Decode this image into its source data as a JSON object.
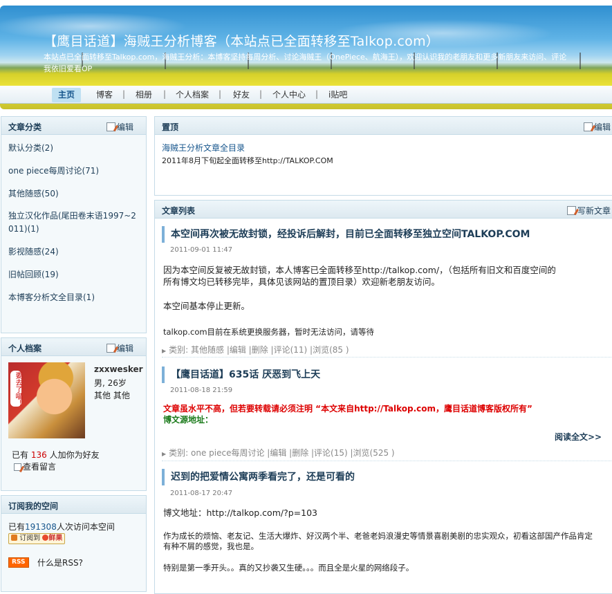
{
  "header": {
    "title": "【鹰目话道】海贼王分析博客（本站点已全面转移至Talkop.com）",
    "description": "本站点已全面转移至Talkop.com，海贼王分析：本博客坚持每周分析、讨论海贼王（OnePiece、航海王），欢迎认识我的老朋友和更多新朋友来访问、评论",
    "description_line2": "我依旧爱看OP"
  },
  "nav": {
    "items": [
      "主页",
      "博客",
      "相册",
      "个人档案",
      "好友",
      "个人中心",
      "i贴吧"
    ],
    "active": "主页",
    "separator": "|"
  },
  "left": {
    "categories": {
      "title": "文章分类",
      "edit": "编辑",
      "items": [
        "默认分类(2)",
        "one piece每周讨论(71)",
        "其他随感(50)",
        "独立汉化作品(尾田卷末语1997~2",
        "011)(1)",
        "影视随感(24)",
        "旧帖回顾(19)",
        "本博客分析文全目录(1)"
      ]
    },
    "profile": {
      "title": "个人档案",
      "edit": "编辑",
      "name": "zxxwesker",
      "gender_age": "男, 26岁",
      "location": "其他 其他",
      "friends_prefix": "已有",
      "friends_count": "136",
      "friends_suffix": "人加你为好友",
      "guestbook": "查看留言",
      "avatar_text": "要去了喵！"
    },
    "subscribe": {
      "title": "订阅我的空间",
      "visits_prefix": "已有",
      "visits": "191308",
      "visits_suffix": "人次访问本空间",
      "feed_button": "订阅到",
      "feed_brand": "鲜果",
      "rss_badge": "RSS",
      "rss_question": "什么是RSS?"
    }
  },
  "right": {
    "pinned": {
      "title": "置顶",
      "edit": "编辑",
      "link1": "海贼王分析文章全目录",
      "link2": "2011年8月下旬起全面转移至http://TALKOP.COM"
    },
    "list": {
      "title": "文章列表",
      "write": "写新文章",
      "articles": [
        {
          "title": "本空间再次被无故封锁，经投诉后解封，目前已全面转移至独立空间TALKOP.COM",
          "date": "2011-09-01 11:47",
          "body": [
            "因为本空间反复被无故封锁，本人博客已全面转移至http://talkop.com/，（包括所有旧文和百度空间的",
            "所有博文均已转移完毕，具体见该网站的置顶目录）欢迎新老朋友访问。",
            "本空间基本停止更新。",
            "talkop.com目前在系统更换服务器，暂时无法访问，请等待"
          ],
          "meta": "类别: 其他随感 |编辑 |删除 |评论(11) |浏览(85 )"
        },
        {
          "title": "【鹰目话道】635话  厌恶到飞上天",
          "date": "2011-08-18 21:59",
          "body_red": "文章虽水平不高，但若要转载请必须注明 “本文来自http://Talkop.com，鹰目话道博客版权所有”",
          "body_green": "博文源地址：",
          "read_more": "阅读全文>>",
          "meta": "类别: one piece每周讨论 |编辑 |删除 |评论(15) |浏览(525 )"
        },
        {
          "title": "迟到的把爱情公寓两季看完了，还是可看的",
          "date": "2011-08-17 20:47",
          "body": [
            "博文地址：http://talkop.com/?p=103",
            "作为成长的烦恼、老友记、生活大爆炸、好汉两个半、老爸老妈浪漫史等情景喜剧美剧的忠实观众，初看这部国产作品肯定",
            "有种不屑的感觉，我也是。",
            "特别是第一季开头。。真的又抄袭又生硬。。。而且全是火星的网络段子。"
          ]
        }
      ]
    }
  },
  "colors": {
    "accent": "#1d3d57",
    "panel_bg": "#f4f9fb",
    "panel_border": "#c5dbe7",
    "nav_active": "#bfe0f2",
    "red": "#dd0000",
    "green": "#1a7a1a",
    "count_red": "#cc0000"
  }
}
